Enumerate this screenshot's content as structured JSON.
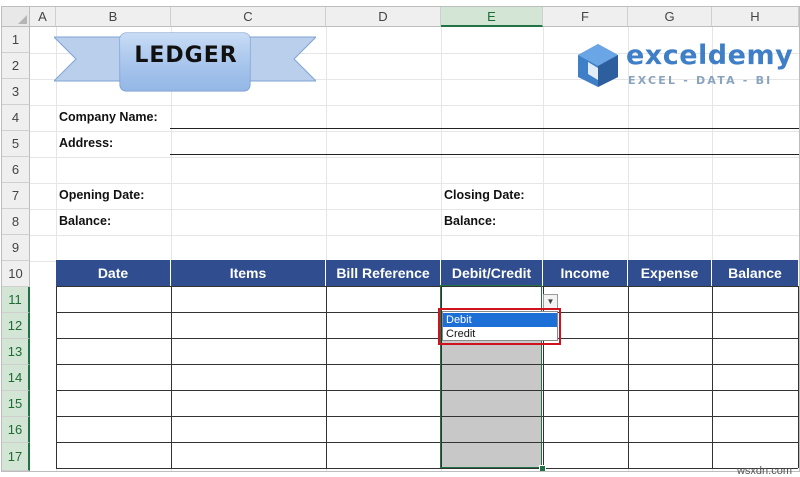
{
  "spreadsheet": {
    "columns": [
      "A",
      "B",
      "C",
      "D",
      "E",
      "F",
      "G",
      "H"
    ],
    "rows": [
      "1",
      "2",
      "3",
      "4",
      "5",
      "6",
      "7",
      "8",
      "9",
      "10",
      "11",
      "12",
      "13",
      "14",
      "15",
      "16",
      "17"
    ],
    "selected_column": "E",
    "selected_rows": [
      "11",
      "12",
      "13",
      "14",
      "15",
      "16",
      "17"
    ]
  },
  "banner": {
    "title": "LEDGER"
  },
  "logo": {
    "name": "exceldemy",
    "tagline": "EXCEL - DATA - BI"
  },
  "form": {
    "company_name_label": "Company Name:",
    "address_label": "Address:",
    "opening_date_label": "Opening Date:",
    "closing_date_label": "Closing Date:",
    "balance_left_label": "Balance:",
    "balance_right_label": "Balance:"
  },
  "ledger_table": {
    "headers": [
      "Date",
      "Items",
      "Bill Reference",
      "Debit/Credit",
      "Income",
      "Expense",
      "Balance"
    ],
    "header_color": "#2f4d8f"
  },
  "dropdown": {
    "options": [
      "Debit",
      "Credit"
    ],
    "highlighted": "Debit",
    "arrow_icon": "▼"
  },
  "watermark": "wsxdn.com"
}
